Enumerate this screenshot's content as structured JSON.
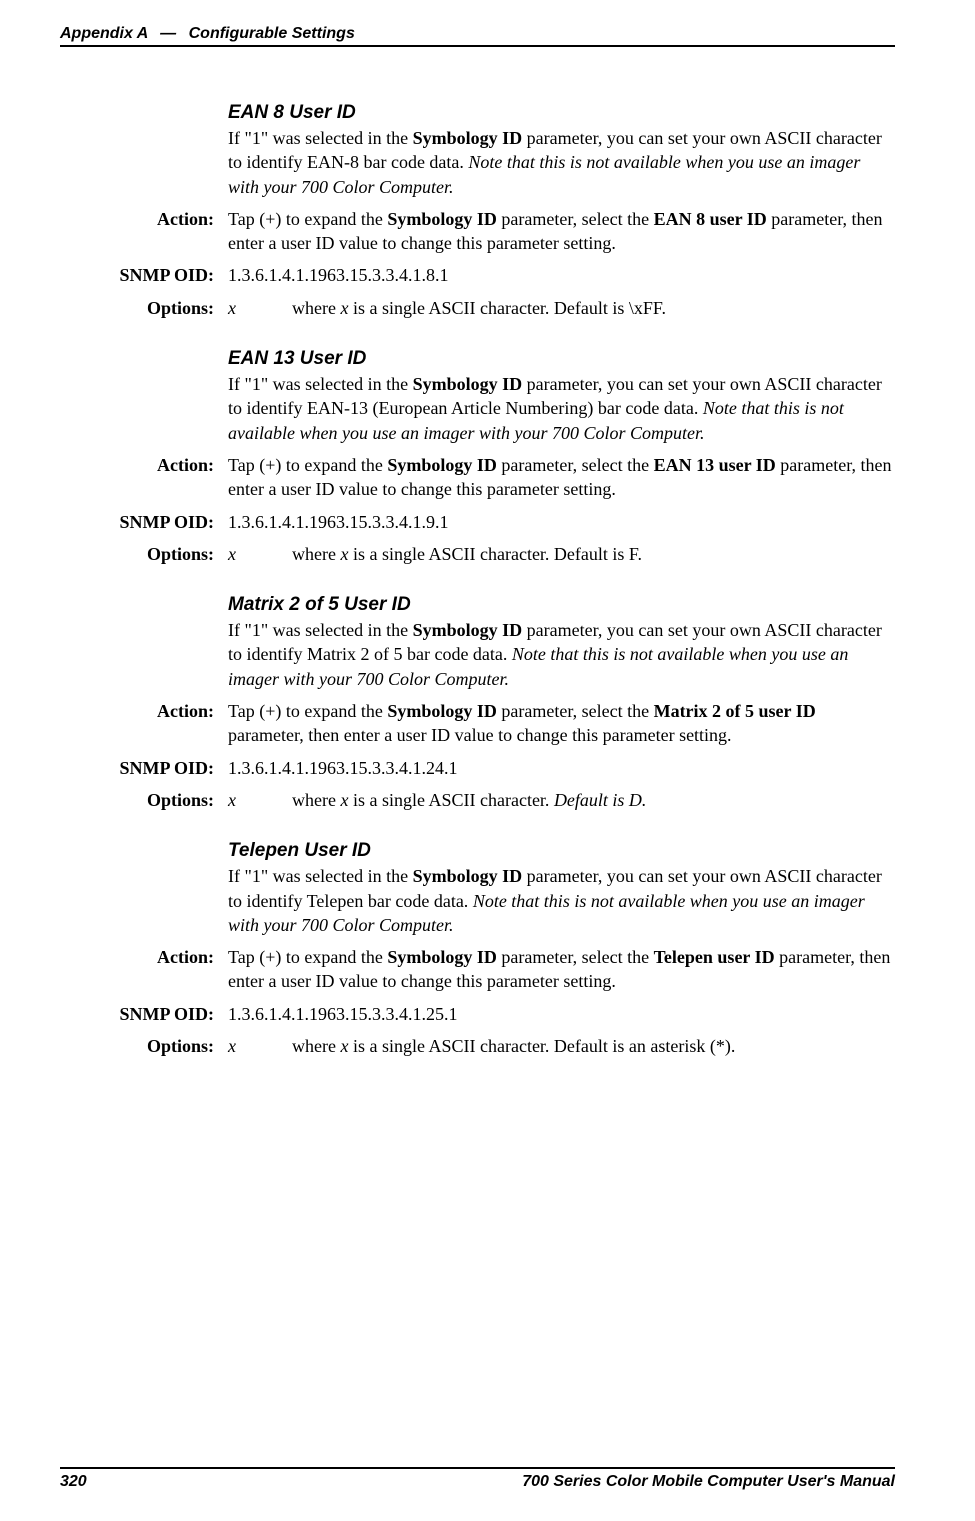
{
  "header": {
    "appendix": "Appendix A",
    "dash": "—",
    "title": "Configurable Settings"
  },
  "labels": {
    "action": "Action:",
    "snmp": "SNMP OID:",
    "options": "Options:",
    "x": "x"
  },
  "sections": [
    {
      "heading": "EAN 8 User ID",
      "desc_pre": "If \"1\" was selected in the ",
      "desc_bold1": "Symbology ID",
      "desc_mid": " parameter, you can set your own ASCII character to identify EAN-8 bar code data. ",
      "desc_italic": "Note that this is not available when you use an imager with your 700 Color Computer.",
      "action_pre": "Tap (+) to expand the ",
      "action_bold1": "Symbology ID",
      "action_mid": " parameter, select the ",
      "action_bold2": "EAN 8 user ID",
      "action_post": " parameter, then enter a user ID value to change this parameter setting.",
      "snmp": "1.3.6.1.4.1.1963.15.3.3.4.1.8.1",
      "option_pre": "where ",
      "option_ital": "x",
      "option_post": " is a single ASCII character. Default is \\xFF.",
      "option_trail_italic": ""
    },
    {
      "heading": "EAN 13 User ID",
      "desc_pre": "If \"1\" was selected in the ",
      "desc_bold1": "Symbology ID",
      "desc_mid": " parameter, you can set your own ASCII character to identify EAN-13 (European Article Numbering) bar code data. ",
      "desc_italic": "Note that this is not available when you use an imager with your 700 Color Computer.",
      "action_pre": "Tap (+) to expand the ",
      "action_bold1": "Symbology ID",
      "action_mid": " parameter, select the ",
      "action_bold2": "EAN 13 user ID",
      "action_post": " parameter, then enter a user ID value to change this parameter setting.",
      "snmp": "1.3.6.1.4.1.1963.15.3.3.4.1.9.1",
      "option_pre": "where ",
      "option_ital": "x",
      "option_post": " is a single ASCII character. Default is F.",
      "option_trail_italic": ""
    },
    {
      "heading": "Matrix 2 of 5 User ID",
      "desc_pre": "If \"1\" was selected in the ",
      "desc_bold1": "Symbology ID",
      "desc_mid": " parameter, you can set your own ASCII character to identify Matrix 2 of 5 bar code data. ",
      "desc_italic": "Note that this is not available when you use an imager with your 700 Color Computer.",
      "action_pre": "Tap (+) to expand the ",
      "action_bold1": "Symbology ID",
      "action_mid": " parameter, select the ",
      "action_bold2": "Matrix 2 of 5 user ID",
      "action_post": " parameter, then enter a user ID value to change this parameter setting.",
      "snmp": "1.3.6.1.4.1.1963.15.3.3.4.1.24.1",
      "option_pre": "where ",
      "option_ital": "x",
      "option_post": " is a single ASCII character. ",
      "option_trail_italic": "Default is D."
    },
    {
      "heading": "Telepen User ID",
      "desc_pre": "If \"1\" was selected in the ",
      "desc_bold1": "Symbology ID",
      "desc_mid": " parameter, you can set your own ASCII character to identify Telepen bar code data. ",
      "desc_italic": "Note that this is not available when you use an imager with your 700 Color Computer.",
      "action_pre": "Tap (+) to expand the ",
      "action_bold1": "Symbology ID",
      "action_mid": " parameter, select the ",
      "action_bold2": "Telepen user ID",
      "action_post": " parameter, then enter a user ID value to change this parameter setting.",
      "snmp": "1.3.6.1.4.1.1963.15.3.3.4.1.25.1",
      "option_pre": "where ",
      "option_ital": "x",
      "option_post": " is a single ASCII character. Default is an asterisk (*).",
      "option_trail_italic": ""
    }
  ],
  "footer": {
    "page": "320",
    "title": "700 Series Color Mobile Computer User's Manual"
  }
}
